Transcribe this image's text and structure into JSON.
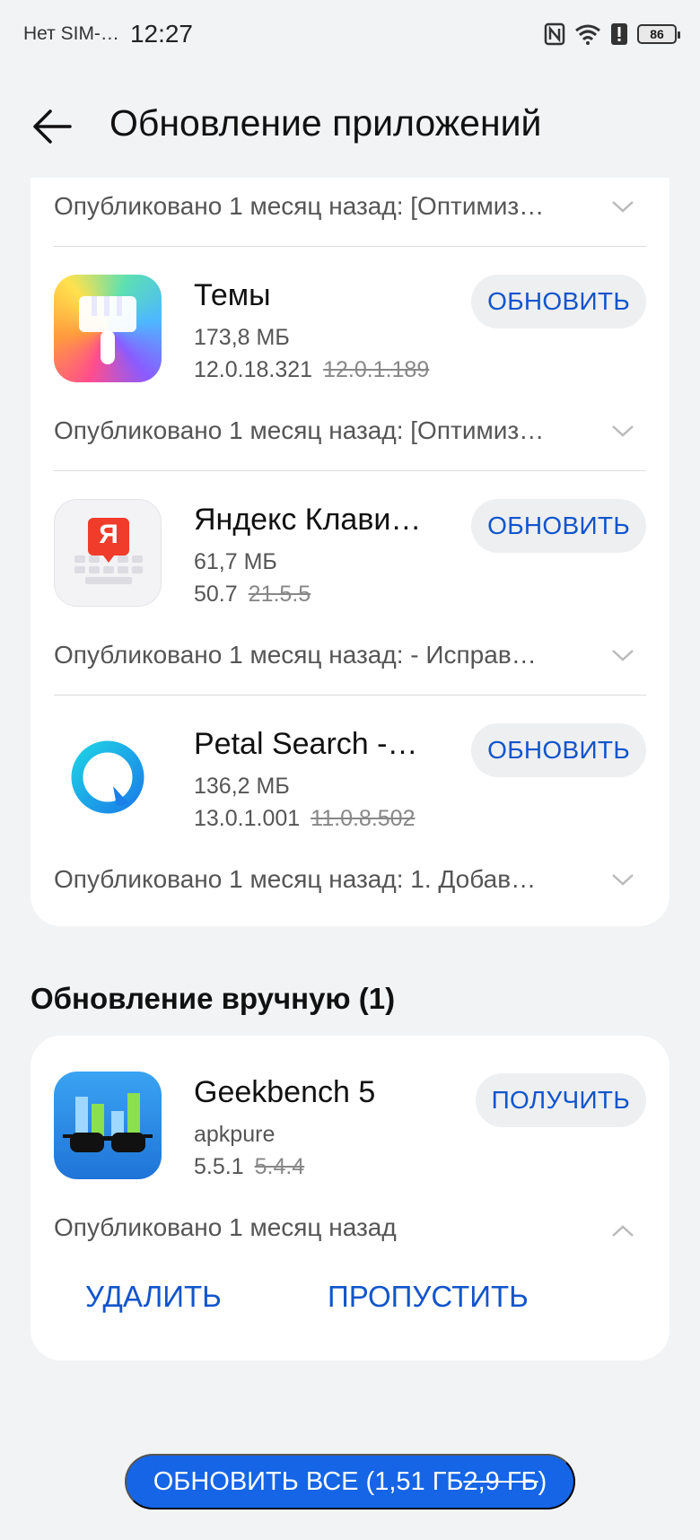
{
  "status_bar": {
    "sim_text": "Нет SIM-…",
    "time": "12:27",
    "battery": "86",
    "icons": [
      "nfc-icon",
      "wifi-icon",
      "alert-icon",
      "battery-icon"
    ]
  },
  "header": {
    "title": "Обновление приложений",
    "back_icon": "back-arrow-icon"
  },
  "top_card": {
    "first_publication": "Опубликовано 1 месяц назад: [Оптимиз…",
    "apps": [
      {
        "name": "Темы",
        "size": "173,8 МБ",
        "new_version": "12.0.18.321",
        "old_version": "12.0.1.189",
        "button": "ОБНОВИТЬ",
        "publication": "Опубликовано 1 месяц назад: [Оптимиз…",
        "icon": "themes-brush-icon"
      },
      {
        "name": "Яндекс Клави…",
        "size": "61,7 МБ",
        "new_version": "50.7",
        "old_version": "21.5.5",
        "button": "ОБНОВИТЬ",
        "publication": "Опубликовано 1 месяц назад: - Исправ…",
        "icon": "yandex-keyboard-icon",
        "icon_letter": "Я"
      },
      {
        "name": "Petal Search -…",
        "size": "136,2 МБ",
        "new_version": "13.0.1.001",
        "old_version": "11.0.8.502",
        "button": "ОБНОВИТЬ",
        "publication": "Опубликовано 1 месяц назад: 1. Добав…",
        "icon": "petal-search-icon"
      }
    ]
  },
  "manual_section": {
    "title": "Обновление вручную (1)",
    "app": {
      "name": "Geekbench 5",
      "source": "apkpure",
      "new_version": "5.5.1",
      "old_version": "5.4.4",
      "button": "ПОЛУЧИТЬ",
      "publication": "Опубликовано 1 месяц назад",
      "icon": "geekbench-icon"
    },
    "delete_label": "УДАЛИТЬ",
    "skip_label": "ПРОПУСТИТЬ"
  },
  "update_all": {
    "label": "ОБНОВИТЬ ВСЕ (1,51 ГБ ",
    "old_size": "2,9 ГБ",
    "suffix": ")"
  },
  "colors": {
    "accent": "#1155cc",
    "primary_button": "#1565e6",
    "background": "#f1f3f5",
    "card": "#ffffff"
  }
}
